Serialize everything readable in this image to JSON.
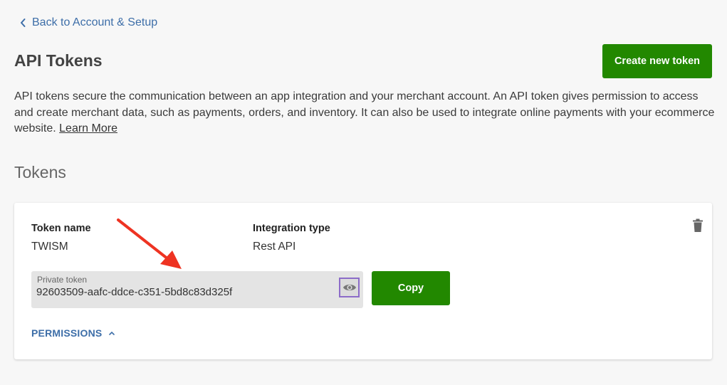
{
  "nav": {
    "back_label": "Back to Account & Setup"
  },
  "header": {
    "title": "API Tokens",
    "create_button": "Create new token"
  },
  "intro": {
    "text": "API tokens secure the communication between an app integration and your merchant account. An API token gives permission to access and create merchant data, such as payments, orders, and inventory. It can also be used to integrate online payments with your ecommerce website. ",
    "learn_more": "Learn More"
  },
  "tokens": {
    "section_title": "Tokens",
    "items": [
      {
        "name_label": "Token name",
        "name": "TWISM",
        "type_label": "Integration type",
        "type": "Rest API",
        "private_label": "Private token",
        "private_value": "92603509-aafc-ddce-c351-5bd8c83d325f",
        "copy_label": "Copy",
        "permissions_label": "PERMISSIONS"
      }
    ]
  },
  "icons": {
    "back": "chevron-left-icon",
    "delete": "trash-icon",
    "reveal": "eye-icon",
    "permissions_toggle": "chevron-up-icon"
  },
  "colors": {
    "primary_button": "#228800",
    "link": "#3d6ea8",
    "annotation_arrow": "#ee3322",
    "focus_ring": "#8c6cc8"
  }
}
